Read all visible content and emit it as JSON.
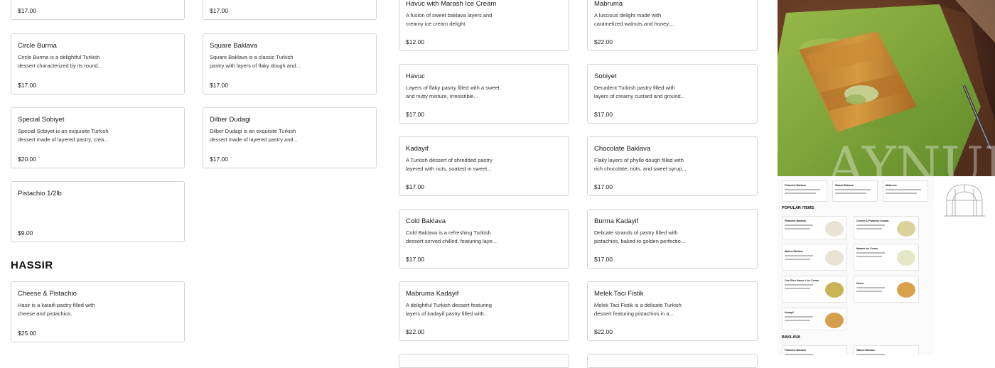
{
  "colors": {
    "card_border": "#d4d4d4",
    "text": "#1a1a1a"
  },
  "cards": [
    {
      "title": "",
      "desc": "",
      "price": "$17.00"
    },
    {
      "title": "",
      "desc": "",
      "price": "$17.00"
    },
    {
      "title": "Circle Burma",
      "desc": "Circle Burma is a delightful Turkish dessert characterized by its round...",
      "price": "$17.00"
    },
    {
      "title": "Square Baklava",
      "desc": "Square Baklava is a classic Turkish pastry with layers of flaky dough and...",
      "price": "$17.00"
    },
    {
      "title": "Special Sobiyet",
      "desc": "Special Sobiyet is an exquisite Turkish dessert made of layered pastry, crea...",
      "price": "$20.00"
    },
    {
      "title": "Dilber Dudagi",
      "desc": "Dilber Dudagi is an exquisite Turkish dessert made of layered pastry and...",
      "price": "$17.00"
    },
    {
      "title": "Pistachio 1/2lb",
      "desc": "",
      "price": "$9.00"
    },
    {
      "title": "Cheese & Pistachio",
      "desc": "Hasir is a kataifi pastry filled with cheese and pistachios.",
      "price": "$25.00"
    },
    {
      "title": "Havuc with Marash Ice Cream",
      "desc": "A fusion of sweet baklava layers and creamy ice cream delight.",
      "price": "$12.00"
    },
    {
      "title": "Mabruma",
      "desc": "A luscious delight made with caramelized walnuts and honey,...",
      "price": "$22.00"
    },
    {
      "title": "Havuc",
      "desc": "Layers of flaky pastry filled with a sweet and nutty mixture, irresistible...",
      "price": "$17.00"
    },
    {
      "title": "Sobiyet",
      "desc": "Decadent Turkish pastry filled with layers of creamy custard and ground...",
      "price": "$17.00"
    },
    {
      "title": "Kadayif",
      "desc": "A Turkish dessert of shredded pastry layered with nuts, soaked in sweet...",
      "price": "$17.00"
    },
    {
      "title": "Chocolate Baklava",
      "desc": "Flaky layers of phyllo dough filled with rich chocolate, nuts, and sweet syrup...",
      "price": "$17.00"
    },
    {
      "title": "Cold Baklava",
      "desc": "Cold Baklava is a refreshing Turkish dessert served chilled, featuring laye...",
      "price": "$17.00"
    },
    {
      "title": "Burma Kadayif",
      "desc": "Delicate strands of pastry filled with pistachios, baked to golden perfectio...",
      "price": "$17.00"
    },
    {
      "title": "Mabruma Kadayif",
      "desc": "A delightful Turkish dessert featuring layers of kadayif pastry filled with...",
      "price": "$22.00"
    },
    {
      "title": "Melek Taci Fistik",
      "desc": "Melek Taci Fistik is a delicate Turkish dessert featuring pistachios in a...",
      "price": "$22.00"
    }
  ],
  "sections": {
    "hassir": "HASSIR"
  },
  "preview": {
    "popular_heading": "POPULAR ITEMS",
    "baklava_heading": "BAKLAVA",
    "top_row": [
      "Pistachio Baklava",
      "Walnut Baklava",
      "Mabruma"
    ],
    "popular_left": [
      "Pistachio Baklava",
      "Walnut Baklava",
      "One Slice Havuc + Ice Cream",
      "Kadayif"
    ],
    "popular_right": [
      "Cheese & Pistachio Kunafa",
      "Marash Ice Cream",
      "Havuc"
    ],
    "baklava_row": [
      "Pistachio Baklava",
      "Walnut Baklava"
    ],
    "photo_overlay_text": "AYNUR"
  }
}
